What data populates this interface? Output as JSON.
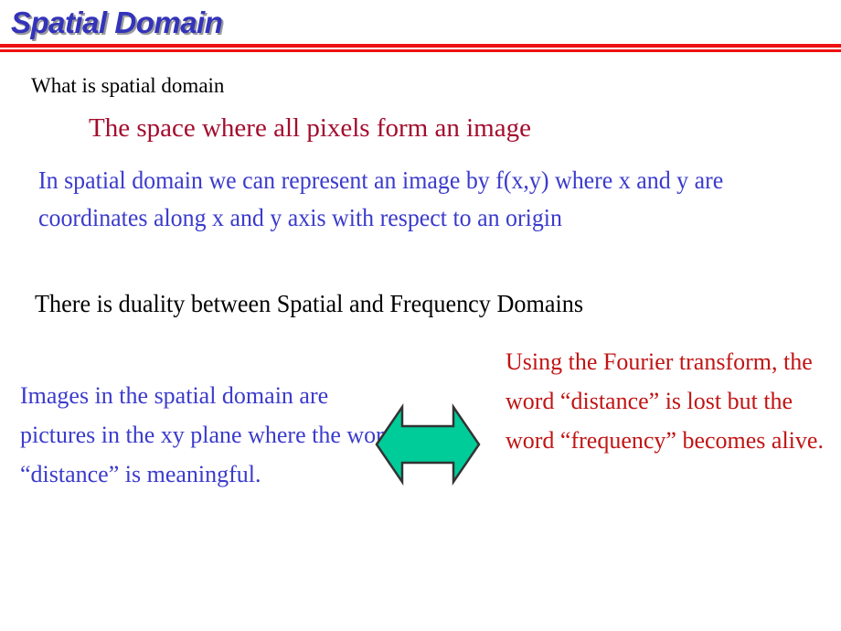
{
  "slide": {
    "title": "Spatial Domain",
    "title_color": "#3333bb",
    "rule_color": "#ee1111",
    "background": "#ffffff"
  },
  "body": {
    "heading_question": "What is spatial domain",
    "definition": "The space where all pixels form an image",
    "definition_color": "#a30d2e",
    "representation_paragraph": "In spatial domain we can represent an image by f(x,y) where x and y are coordinates along x and y axis with respect to an origin",
    "representation_color": "#3b3bcc",
    "duality_statement": "There is duality between Spatial and Frequency Domains"
  },
  "comparison": {
    "left": {
      "text": "Images in the spatial domain are pictures in the xy plane where the word “distance” is meaningful.",
      "color": "#3b3bcc"
    },
    "right": {
      "text": "Using the Fourier transform, the word “distance” is lost but the word “frequency” becomes alive.",
      "color": "#c11414"
    },
    "connector": {
      "icon": "double-headed-arrow-icon",
      "fill": "#00cc99",
      "stroke": "#333333"
    }
  }
}
